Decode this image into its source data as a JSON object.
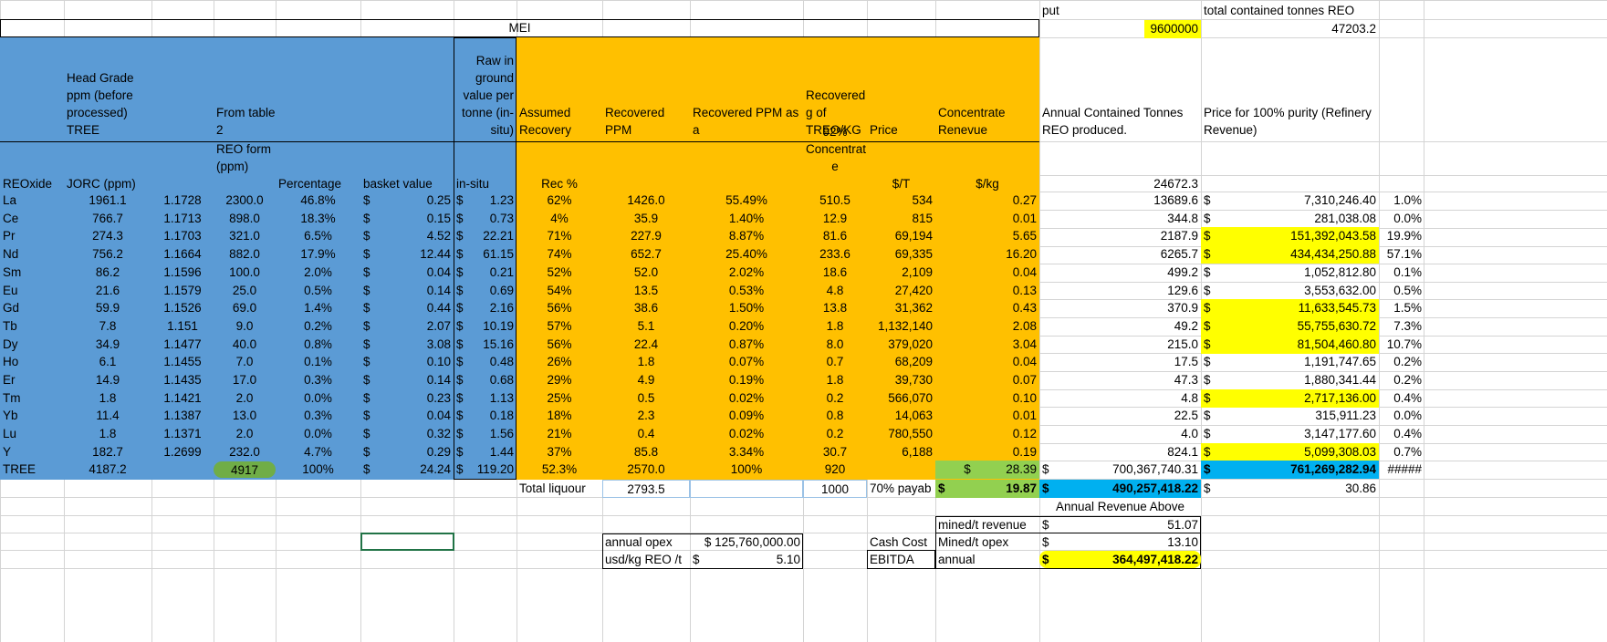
{
  "top": {
    "put_label": "put",
    "put_value": "9600000",
    "total_label": "total contained tonnes REO",
    "total_value": "47203.2",
    "mei_title": "MEI"
  },
  "headers": {
    "head_grade": "Head Grade\nppm (before\nprocessed)\nTREE",
    "from_table": "From table\n2",
    "raw_value": "Raw in\nground\nvalue per\ntonne (in-\nsitu)",
    "assumed_recovery": "Assumed\nRecovery",
    "recovered_ppm_calc": "Recovered PPM\nCalculated",
    "recovered_ppm_pct": "Recovered PPM as a\n%",
    "recovered_g": "Recovered\ng of\nTREO/KG",
    "price": "Price",
    "concentrate_revenue": "Concentrate\nRenevue",
    "annual_contained": "Annual Contained Tonnes\nREO produced.",
    "price_100": "Price for 100% purity (Refinery\nRevenue)",
    "concentrate_92": "92%\nConcentrat\ne",
    "reo_form": "REO form\n(ppm)",
    "reoxide": "REOxide",
    "jorc": "JORC (ppm)",
    "percentage": "Percentage",
    "basket_value": "basket value",
    "in_situ": "in-situ",
    "rec_pct": "Rec %",
    "usd_t": "$/T",
    "usd_kg": "$/kg",
    "sum_annual": "24672.3"
  },
  "rows": [
    {
      "el": "La",
      "jorc": "1961.1",
      "f": "1.1728",
      "reo": "2300.0",
      "pct": "46.8%",
      "bv": "0.25",
      "ins": "1.23",
      "rec": "62%",
      "rpc": "1426.0",
      "rpp": "55.49%",
      "g": "510.5",
      "price": "534",
      "conc": "0.27",
      "ann": "13689.6",
      "rev": "7,310,246.40",
      "share": "1.0%",
      "hl": false
    },
    {
      "el": "Ce",
      "jorc": "766.7",
      "f": "1.1713",
      "reo": "898.0",
      "pct": "18.3%",
      "bv": "0.15",
      "ins": "0.73",
      "rec": "4%",
      "rpc": "35.9",
      "rpp": "1.40%",
      "g": "12.9",
      "price": "815",
      "conc": "0.01",
      "ann": "344.8",
      "rev": "281,038.08",
      "share": "0.0%",
      "hl": false
    },
    {
      "el": "Pr",
      "jorc": "274.3",
      "f": "1.1703",
      "reo": "321.0",
      "pct": "6.5%",
      "bv": "4.52",
      "ins": "22.21",
      "rec": "71%",
      "rpc": "227.9",
      "rpp": "8.87%",
      "g": "81.6",
      "price": "69,194",
      "conc": "5.65",
      "ann": "2187.9",
      "rev": "151,392,043.58",
      "share": "19.9%",
      "hl": true
    },
    {
      "el": "Nd",
      "jorc": "756.2",
      "f": "1.1664",
      "reo": "882.0",
      "pct": "17.9%",
      "bv": "12.44",
      "ins": "61.15",
      "rec": "74%",
      "rpc": "652.7",
      "rpp": "25.40%",
      "g": "233.6",
      "price": "69,335",
      "conc": "16.20",
      "ann": "6265.7",
      "rev": "434,434,250.88",
      "share": "57.1%",
      "hl": true
    },
    {
      "el": "Sm",
      "jorc": "86.2",
      "f": "1.1596",
      "reo": "100.0",
      "pct": "2.0%",
      "bv": "0.04",
      "ins": "0.21",
      "rec": "52%",
      "rpc": "52.0",
      "rpp": "2.02%",
      "g": "18.6",
      "price": "2,109",
      "conc": "0.04",
      "ann": "499.2",
      "rev": "1,052,812.80",
      "share": "0.1%",
      "hl": false
    },
    {
      "el": "Eu",
      "jorc": "21.6",
      "f": "1.1579",
      "reo": "25.0",
      "pct": "0.5%",
      "bv": "0.14",
      "ins": "0.69",
      "rec": "54%",
      "rpc": "13.5",
      "rpp": "0.53%",
      "g": "4.8",
      "price": "27,420",
      "conc": "0.13",
      "ann": "129.6",
      "rev": "3,553,632.00",
      "share": "0.5%",
      "hl": false
    },
    {
      "el": "Gd",
      "jorc": "59.9",
      "f": "1.1526",
      "reo": "69.0",
      "pct": "1.4%",
      "bv": "0.44",
      "ins": "2.16",
      "rec": "56%",
      "rpc": "38.6",
      "rpp": "1.50%",
      "g": "13.8",
      "price": "31,362",
      "conc": "0.43",
      "ann": "370.9",
      "rev": "11,633,545.73",
      "share": "1.5%",
      "hl": true
    },
    {
      "el": "Tb",
      "jorc": "7.8",
      "f": "1.151",
      "reo": "9.0",
      "pct": "0.2%",
      "bv": "2.07",
      "ins": "10.19",
      "rec": "57%",
      "rpc": "5.1",
      "rpp": "0.20%",
      "g": "1.8",
      "price": "1,132,140",
      "conc": "2.08",
      "ann": "49.2",
      "rev": "55,755,630.72",
      "share": "7.3%",
      "hl": true
    },
    {
      "el": "Dy",
      "jorc": "34.9",
      "f": "1.1477",
      "reo": "40.0",
      "pct": "0.8%",
      "bv": "3.08",
      "ins": "15.16",
      "rec": "56%",
      "rpc": "22.4",
      "rpp": "0.87%",
      "g": "8.0",
      "price": "379,020",
      "conc": "3.04",
      "ann": "215.0",
      "rev": "81,504,460.80",
      "share": "10.7%",
      "hl": true
    },
    {
      "el": "Ho",
      "jorc": "6.1",
      "f": "1.1455",
      "reo": "7.0",
      "pct": "0.1%",
      "bv": "0.10",
      "ins": "0.48",
      "rec": "26%",
      "rpc": "1.8",
      "rpp": "0.07%",
      "g": "0.7",
      "price": "68,209",
      "conc": "0.04",
      "ann": "17.5",
      "rev": "1,191,747.65",
      "share": "0.2%",
      "hl": false
    },
    {
      "el": "Er",
      "jorc": "14.9",
      "f": "1.1435",
      "reo": "17.0",
      "pct": "0.3%",
      "bv": "0.14",
      "ins": "0.68",
      "rec": "29%",
      "rpc": "4.9",
      "rpp": "0.19%",
      "g": "1.8",
      "price": "39,730",
      "conc": "0.07",
      "ann": "47.3",
      "rev": "1,880,341.44",
      "share": "0.2%",
      "hl": false
    },
    {
      "el": "Tm",
      "jorc": "1.8",
      "f": "1.1421",
      "reo": "2.0",
      "pct": "0.0%",
      "bv": "0.23",
      "ins": "1.13",
      "rec": "25%",
      "rpc": "0.5",
      "rpp": "0.02%",
      "g": "0.2",
      "price": "566,070",
      "conc": "0.10",
      "ann": "4.8",
      "rev": "2,717,136.00",
      "share": "0.4%",
      "hl": true
    },
    {
      "el": "Yb",
      "jorc": "11.4",
      "f": "1.1387",
      "reo": "13.0",
      "pct": "0.3%",
      "bv": "0.04",
      "ins": "0.18",
      "rec": "18%",
      "rpc": "2.3",
      "rpp": "0.09%",
      "g": "0.8",
      "price": "14,063",
      "conc": "0.01",
      "ann": "22.5",
      "rev": "315,911.23",
      "share": "0.0%",
      "hl": false
    },
    {
      "el": "Lu",
      "jorc": "1.8",
      "f": "1.1371",
      "reo": "2.0",
      "pct": "0.0%",
      "bv": "0.32",
      "ins": "1.56",
      "rec": "21%",
      "rpc": "0.4",
      "rpp": "0.02%",
      "g": "0.2",
      "price": "780,550",
      "conc": "0.12",
      "ann": "4.0",
      "rev": "3,147,177.60",
      "share": "0.4%",
      "hl": false
    },
    {
      "el": "Y",
      "jorc": "182.7",
      "f": "1.2699",
      "reo": "232.0",
      "pct": "4.7%",
      "bv": "0.29",
      "ins": "1.44",
      "rec": "37%",
      "rpc": "85.8",
      "rpp": "3.34%",
      "g": "30.7",
      "price": "6,188",
      "conc": "0.19",
      "ann": "824.1",
      "rev": "5,099,308.03",
      "share": "0.7%",
      "hl": true
    }
  ],
  "total": {
    "el": "TREE",
    "jorc": "4187.2",
    "reo": "4917",
    "pct": "100%",
    "bv": "24.24",
    "ins": "119.20",
    "rec": "52.3%",
    "rpc": "2570.0",
    "rpp": "100%",
    "g": "920",
    "conc": "28.39",
    "ann": "700,367,740.31",
    "rev": "761,269,282.94",
    "share": "#####"
  },
  "below": {
    "liquor_label": "Total liquour cc",
    "liquor_value": "2793.5",
    "g_value": "1000",
    "payable_label": "70% payab",
    "payable_value": "19.87",
    "payable_total": "490,257,418.22",
    "per_unit": "30.86",
    "annual_revenue_above": "Annual Revenue Above",
    "mined_rev_label": "mined/t revenue",
    "mined_rev_value": "51.07",
    "opex_label": "annual opex",
    "opex_value": "$ 125,760,000.00",
    "cash_cost_label": "Cash Cost",
    "mined_opex_label": "Mined/t opex",
    "mined_opex_value": "13.10",
    "usd_kg_label": "usd/kg REO /t",
    "usd_kg_value": "5.10",
    "ebitda_label": "EBITDA",
    "annual_label": "annual",
    "ebitda_value": "364,497,418.22",
    "dollar": "$"
  }
}
